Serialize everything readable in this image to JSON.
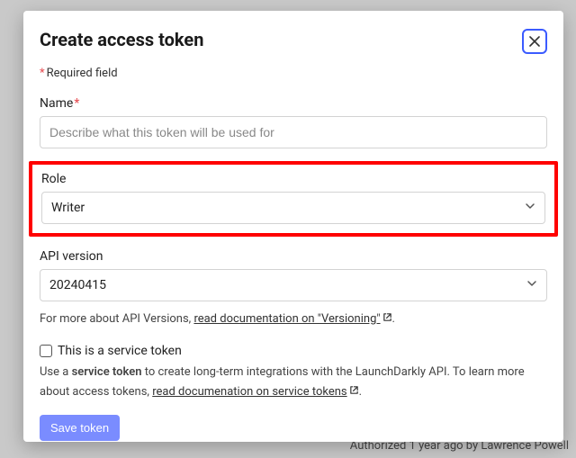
{
  "modal": {
    "title": "Create access token",
    "required_note": "Required field",
    "name": {
      "label": "Name",
      "placeholder": "Describe what this token will be used for"
    },
    "role": {
      "label": "Role",
      "value": "Writer"
    },
    "api_version": {
      "label": "API version",
      "value": "20240415",
      "help_prefix": "For more about API Versions, ",
      "help_link": "read documentation on \"Versioning\"",
      "help_suffix": "."
    },
    "service_token": {
      "checkbox_label": "This is a service token",
      "desc_pre": "Use a ",
      "desc_bold": "service token",
      "desc_mid": " to create long-term integrations with the LaunchDarkly API. To learn more about access tokens, ",
      "desc_link": "read documenation on service tokens",
      "desc_suffix": "."
    },
    "save_label": "Save token"
  },
  "background": {
    "footer": "Authorized 1 year ago by Lawrence Powell"
  }
}
